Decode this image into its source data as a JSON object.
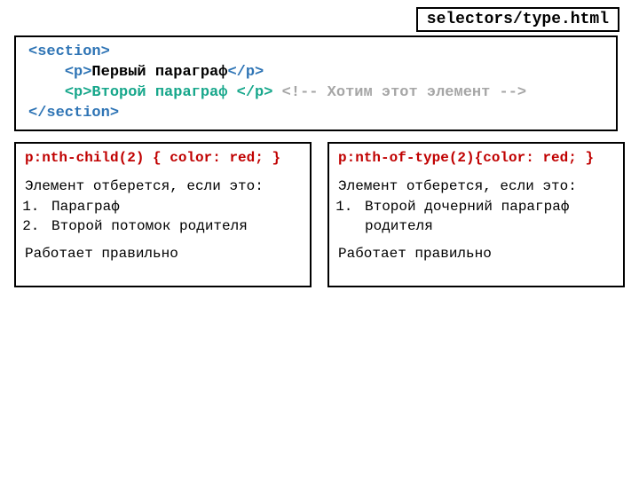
{
  "file": {
    "label": "selectors/type.html"
  },
  "code": {
    "l1": "<section>",
    "l2_indent": "    ",
    "l2_open": "<p>",
    "l2_text": "Первый параграф",
    "l2_close": "</p>",
    "l3_indent": "    ",
    "l3_open": "<p>",
    "l3_text": "Второй параграф ",
    "l3_close": "</p>",
    "l3_sp": " ",
    "l3_comment": "<!-- Хотим этот элемент -->",
    "l4": "</section>"
  },
  "left": {
    "rule": "p:nth-child(2) { color: red; }",
    "cond": "Элемент отберется, если это:",
    "items": [
      "Параграф",
      "Второй потомок родителя"
    ],
    "result": "Работает правильно"
  },
  "right": {
    "rule": "p:nth-of-type(2){color: red; }",
    "cond": "Элемент отберется, если это:",
    "items": [
      "Второй дочерний параграф родителя"
    ],
    "result": "Работает правильно"
  }
}
